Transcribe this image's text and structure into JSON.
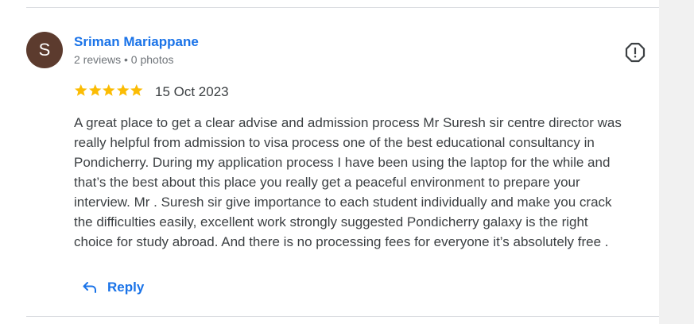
{
  "review": {
    "avatar_initial": "S",
    "author_name": "Sriman Mariappane",
    "author_meta": "2 reviews • 0 photos",
    "rating": 5,
    "date": "15 Oct 2023",
    "text_lines": [
      "A great place to get a clear advise and admission process Mr Suresh sir centre director was",
      "really helpful from admission to visa process one of the best educational consultancy in",
      "Pondicherry. During my application process I have been using the laptop for the while and",
      "that’s the best about this place you really get a peaceful environment to prepare your",
      "interview. Mr . Suresh sir give importance to each student individually and make you crack",
      "the difficulties easily, excellent work strongly suggested Pondicherry galaxy is the right",
      "choice for study abroad. And there is no processing fees for everyone it’s absolutely free ."
    ],
    "reply_label": "Reply"
  },
  "icons": {
    "report": "report-icon",
    "star": "star-icon",
    "reply": "reply-arrow-icon"
  },
  "colors": {
    "accent": "#1a73e8",
    "star": "#fbbc04",
    "avatar": "#5c3b2e",
    "text": "#3c4043",
    "meta": "#70757a"
  }
}
